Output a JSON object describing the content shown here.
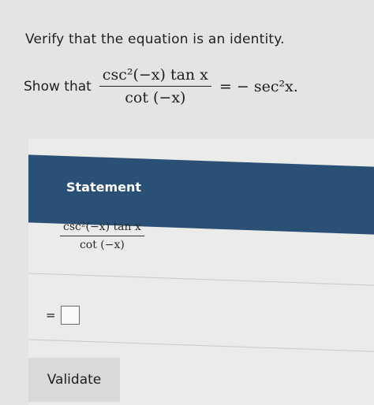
{
  "prompt": "Verify that the equation is an identity.",
  "show_that": {
    "label": "Show that",
    "numerator": "csc²(−x) tan x",
    "denominator": "cot (−x)",
    "rhs": "= − sec²x."
  },
  "table": {
    "header": "Statement",
    "statement_numerator": "csc²(−x) tan x",
    "statement_denominator": "cot (−x)",
    "equals": "="
  },
  "validate_label": "Validate",
  "colors": {
    "header_bg": "#2a5076",
    "page_bg": "#e4e5e2"
  }
}
